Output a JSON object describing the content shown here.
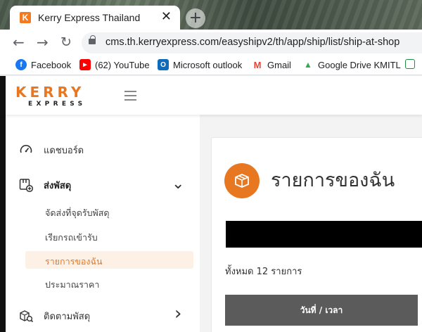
{
  "browser": {
    "tab_title": "Kerry Express Thailand",
    "tab_favicon": "K",
    "close_glyph": "✕",
    "newtab_glyph": "+",
    "url": "cms.th.kerryexpress.com/easyshipv2/th/app/ship/list/ship-at-shop",
    "bookmarks": [
      {
        "label": "Facebook",
        "icon": "facebook-icon",
        "color": "#1877f2",
        "glyph": "f"
      },
      {
        "label": "(62) YouTube",
        "icon": "youtube-icon",
        "color": "#ff0000",
        "glyph": "▶"
      },
      {
        "label": "Microsoft outlook",
        "icon": "outlook-icon",
        "color": "#0f6cbd",
        "glyph": "O"
      },
      {
        "label": "Gmail",
        "icon": "gmail-icon",
        "color": "#ea4335",
        "glyph": "M"
      },
      {
        "label": "Google Drive KMITL",
        "icon": "google-drive-icon",
        "color": "#34a853",
        "glyph": "▲"
      }
    ]
  },
  "app": {
    "logo_main": "KERRY",
    "logo_sub": "EXPRESS",
    "accent": "#e87722"
  },
  "sidebar": {
    "dashboard": "แดชบอร์ด",
    "ship": "ส่งพัสดุ",
    "sub_items": [
      {
        "label": "จัดส่งที่จุดรับพัสดุ"
      },
      {
        "label": "เรียกรถเข้ารับ"
      },
      {
        "label": "รายการของฉัน"
      },
      {
        "label": "ประมาณราคา"
      }
    ],
    "track": "ติดตามพัสดุ",
    "chevron_down": "⌄",
    "chevron_right": "›"
  },
  "main": {
    "title": "รายการของฉัน",
    "total_text": "ทั้งหมด 12 รายการ",
    "table_header_date": "วันที่ / เวลา"
  }
}
